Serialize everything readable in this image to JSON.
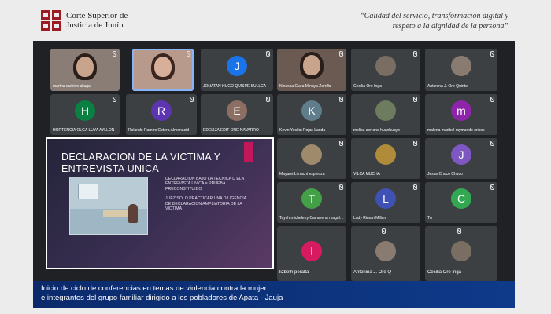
{
  "header": {
    "org_line1": "Corte Superior de",
    "org_line2": "Justicia de Junín",
    "motto_line1": "“Calidad del servicio, transformación digital y",
    "motto_line2": "respeto a la dignidad de la persona”"
  },
  "colors": {
    "brand_red": "#9c1c24",
    "caption_blue": "#0e3a8a",
    "meet_bg": "#202124",
    "tile_bg": "#3c4043"
  },
  "participants": [
    {
      "name": "martha quinino aliaga",
      "type": "video",
      "muted": true
    },
    {
      "name": "",
      "type": "video",
      "muted": true,
      "highlighted": true
    },
    {
      "name": "JONATAN HUGO QUISPE SULLCA",
      "initial": "J",
      "color": "#1a73e8",
      "muted": true
    },
    {
      "name": "Ninoska Clara Minaya Zorrilla",
      "type": "video",
      "muted": true
    },
    {
      "name": "Cecilia Ore Inga",
      "type": "photo",
      "muted": true
    },
    {
      "name": "Antonina J. Ore Quinto",
      "type": "photo",
      "muted": true
    },
    {
      "name": "HORTENCIA OLGA LUYA AYLLON",
      "initial": "H",
      "color": "#0b8043",
      "muted": true
    },
    {
      "name": "Rolando Ramiro Cotera Almonacid",
      "initial": "R",
      "color": "#5e35b1",
      "muted": true
    },
    {
      "name": "EDELIZA EDIT ORE NAVARRO",
      "initial": "E",
      "color": "#8d6e63",
      "muted": true
    },
    {
      "name": "Kevin Yosifat Rojas Landa",
      "initial": "K",
      "color": "#607d8b",
      "muted": true
    },
    {
      "name": "melisa serrano huanhuayo",
      "type": "photo",
      "muted": true
    },
    {
      "name": "malena maribel raymundo orisos",
      "initial": "m",
      "color": "#8e24aa",
      "muted": true
    },
    {
      "name": "Mayumi Limachi espinoza",
      "type": "photo",
      "muted": true
    },
    {
      "name": "VILCA MUCHA",
      "type": "photo",
      "muted": true
    },
    {
      "name": "Jesus Chuco Chuco",
      "initial": "J",
      "color": "#7e57c2",
      "muted": true
    },
    {
      "name": "Taych micheleny Camarena magallanes",
      "initial": "T",
      "color": "#43a047",
      "muted": true
    },
    {
      "name": "Lady Rimari Millan",
      "initial": "L",
      "color": "#3f51b5",
      "muted": true
    },
    {
      "name": "Tú",
      "initial": "C",
      "color": "#33a852",
      "muted": true
    },
    {
      "name": "lizbeth peralta",
      "initial": "l",
      "color": "#d81b60",
      "muted": true
    },
    {
      "name": "Antonina J. Ore Q",
      "type": "photo",
      "muted": true
    },
    {
      "name": "Cecilia Ore Inga",
      "type": "photo",
      "muted": true
    }
  ],
  "slide": {
    "title_line1": "DECLARACION DE LA VICTIMA Y",
    "title_line2": "ENTREVISTA UNICA",
    "bullet1": "DECLARACION BAJO LA TECNICA D ELA ENTREVISTA UNICA = PRUEBA PRECONSTITUIDO",
    "bullet2": "JUEZ SOLO PRACTICAR UNA DILIGENCIA DE DECLARACION AMPLIATORIA DE LA VICTIMA"
  },
  "caption": {
    "line1": "Inicio de ciclo de conferencias en temas de violencia contra la mujer",
    "line2": "e integrantes del grupo familiar dirigido a los pobladores de Apata - Jauja"
  }
}
